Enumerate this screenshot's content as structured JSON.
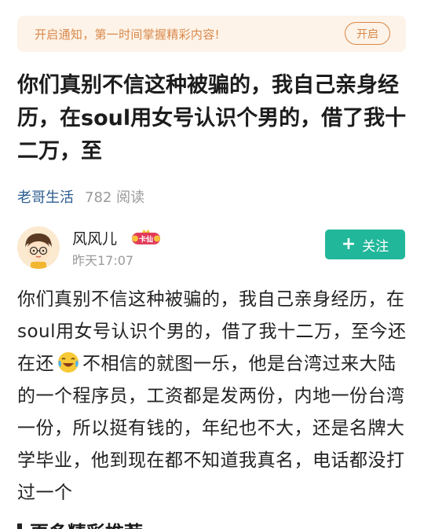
{
  "notice": {
    "text": "开启通知，第一时间掌握精彩内容!",
    "button": "开启"
  },
  "article": {
    "title": "你们真别不信这种被骗的，我自己亲身经历，在soul用女号认识个男的，借了我十二万，至",
    "channel": "老哥生活",
    "reads": "782 阅读",
    "body_part1": "你们真别不信这种被骗的，我自己亲身经历，在soul用女号认识个男的，借了我十二万，至今还在还",
    "body_emoji": "crying-laughing-emoji",
    "body_part2": "不相信的就图一乐，他是台湾过来大陆的一个程序员，工资都是发两份，内地一份台湾一份，所以挺有钱的，年纪也不大，还是名牌大学毕业，他到现在都不知道我真名，电话都没打过一个"
  },
  "author": {
    "name": "风风儿",
    "badge": "卡仙",
    "time": "昨天17:07",
    "follow_label": "关注",
    "avatar_icon": "cartoon-avatar-icon"
  },
  "next_section": {
    "title": "更多精彩推荐"
  },
  "colors": {
    "notice_bg": "#fdf3e8",
    "notice_accent": "#d9884a",
    "channel": "#2d5c8e",
    "follow_bg": "#21b79a",
    "muted": "#9a9a9a"
  }
}
